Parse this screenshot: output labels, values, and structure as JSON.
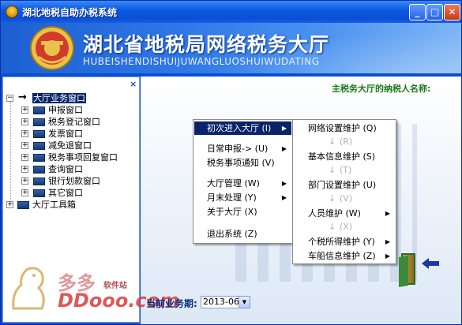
{
  "window": {
    "title": "湖北地税自助办税系统",
    "buttons": {
      "minimize": "_",
      "maximize": "□",
      "close": "✕"
    }
  },
  "banner": {
    "title": "湖北省地税局网络税务大厅",
    "subtitle": "HUBEISHENDISHUIJUWANGLUOSHUIWUDATING"
  },
  "tree": {
    "close_label": "×",
    "root": "大厅业务窗口",
    "children": [
      "申报窗口",
      "税务登记窗口",
      "发票窗口",
      "减免退窗口",
      "税务事项回复窗口",
      "查询窗口",
      "银行划款窗口",
      "其它窗口"
    ],
    "toolbox": "大厅工具箱"
  },
  "taxpayer_label": "主税务大厅的纳税人名称:",
  "context_menu": {
    "items": [
      {
        "label": "初次进入大厅 (I)",
        "submenu": true
      },
      {
        "label": "日常申报-> (U)",
        "submenu": true
      },
      {
        "label": "税务事项通知 (V)",
        "submenu": false
      },
      {
        "label": "大厅管理 (W)",
        "submenu": true
      },
      {
        "label": "月末处理 (Y)",
        "submenu": true
      },
      {
        "label": "关于大厅 (X)",
        "submenu": false
      },
      {
        "label": "退出系统 (Z)",
        "submenu": false
      }
    ]
  },
  "submenu": {
    "items": [
      {
        "label": "网络设置维护 (Q)",
        "submenu": false
      },
      {
        "label": "(R)",
        "disabled": true
      },
      {
        "label": "基本信息维护 (S)",
        "submenu": false
      },
      {
        "label": "(T)",
        "disabled": true
      },
      {
        "label": "部门设置维护 (U)",
        "submenu": false
      },
      {
        "label": "(V)",
        "disabled": true
      },
      {
        "label": "人员维护 (W)",
        "submenu": true
      },
      {
        "label": "(X)",
        "disabled": true
      },
      {
        "label": "个税所得维护 (Y)",
        "submenu": true
      },
      {
        "label": "车船信息维护 (Z)",
        "submenu": true
      }
    ]
  },
  "period": {
    "label": "当前业务期:",
    "value": "2013-06"
  },
  "watermark": {
    "top": "多多",
    "top2": "软件站",
    "url": "DDooo.com"
  }
}
